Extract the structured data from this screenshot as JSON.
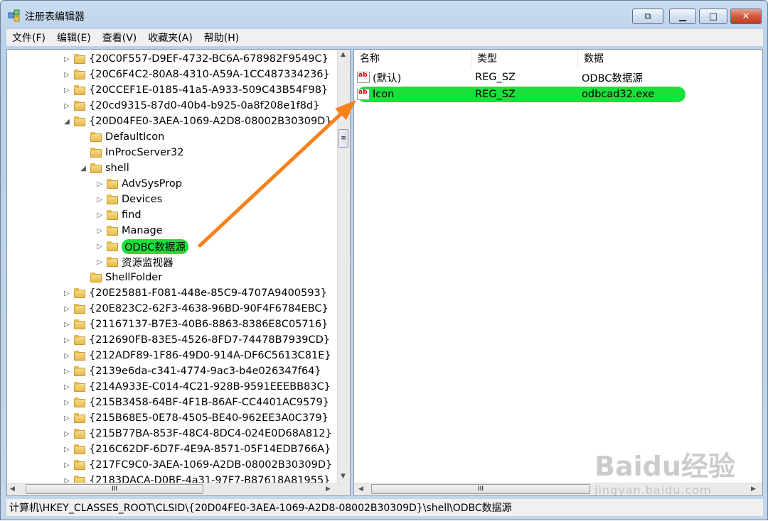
{
  "window": {
    "title": "注册表编辑器"
  },
  "menu": [
    "文件(F)",
    "编辑(E)",
    "查看(V)",
    "收藏夹(A)",
    "帮助(H)"
  ],
  "tree": [
    {
      "label": "{20C0F557-D9EF-4732-BC6A-678982F9549C}",
      "level": 0,
      "expander": "collapsed"
    },
    {
      "label": "{20C6F4C2-80A8-4310-A59A-1CC487334236}",
      "level": 0,
      "expander": "collapsed"
    },
    {
      "label": "{20CCEF1E-0185-41a5-A933-509C43B54F98}",
      "level": 0,
      "expander": "collapsed"
    },
    {
      "label": "{20cd9315-87d0-40b4-b925-0a8f208e1f8d}",
      "level": 0,
      "expander": "collapsed"
    },
    {
      "label": "{20D04FE0-3AEA-1069-A2D8-08002B30309D}",
      "level": 0,
      "expander": "expanded"
    },
    {
      "label": "DefaultIcon",
      "level": 1,
      "expander": "none"
    },
    {
      "label": "InProcServer32",
      "level": 1,
      "expander": "none"
    },
    {
      "label": "shell",
      "level": 1,
      "expander": "expanded"
    },
    {
      "label": "AdvSysProp",
      "level": 2,
      "expander": "collapsed"
    },
    {
      "label": "Devices",
      "level": 2,
      "expander": "collapsed"
    },
    {
      "label": "find",
      "level": 2,
      "expander": "collapsed"
    },
    {
      "label": "Manage",
      "level": 2,
      "expander": "collapsed"
    },
    {
      "label": "ODBC数据源",
      "level": 2,
      "expander": "collapsed",
      "highlight": true
    },
    {
      "label": "资源监视器",
      "level": 2,
      "expander": "collapsed"
    },
    {
      "label": "ShellFolder",
      "level": 1,
      "expander": "none"
    },
    {
      "label": "{20E25881-F081-448e-85C9-4707A9400593}",
      "level": 0,
      "expander": "collapsed"
    },
    {
      "label": "{20E823C2-62F3-4638-96BD-90F4F6784EBC}",
      "level": 0,
      "expander": "collapsed"
    },
    {
      "label": "{21167137-B7E3-40B6-8863-8386E8C05716}",
      "level": 0,
      "expander": "collapsed"
    },
    {
      "label": "{212690FB-83E5-4526-8FD7-74478B7939CD}",
      "level": 0,
      "expander": "collapsed"
    },
    {
      "label": "{212ADF89-1F86-49D0-914A-DF6C5613C81E}",
      "level": 0,
      "expander": "collapsed"
    },
    {
      "label": "{2139e6da-c341-4774-9ac3-b4e026347f64}",
      "level": 0,
      "expander": "collapsed"
    },
    {
      "label": "{214A933E-C014-4C21-928B-9591EEEBB83C}",
      "level": 0,
      "expander": "collapsed"
    },
    {
      "label": "{215B3458-64BF-4F1B-86AF-CC4401AC9579}",
      "level": 0,
      "expander": "collapsed"
    },
    {
      "label": "{215B68E5-0E78-4505-BE40-962EE3A0C379}",
      "level": 0,
      "expander": "collapsed"
    },
    {
      "label": "{215B77BA-853F-48C4-8DC4-024E0D68A812}",
      "level": 0,
      "expander": "collapsed"
    },
    {
      "label": "{216C62DF-6D7F-4E9A-8571-05F14EDB766A}",
      "level": 0,
      "expander": "collapsed"
    },
    {
      "label": "{217FC9C0-3AEA-1069-A2DB-08002B30309D}",
      "level": 0,
      "expander": "collapsed"
    },
    {
      "label": "{2183DACA-D0BF-4a31-97F7-B87618A81955}",
      "level": 0,
      "expander": "collapsed"
    }
  ],
  "list": {
    "columns": [
      "名称",
      "类型",
      "数据"
    ],
    "rows": [
      {
        "name": "(默认)",
        "type": "REG_SZ",
        "data": "ODBC数据源",
        "highlight": false
      },
      {
        "name": "Icon",
        "type": "REG_SZ",
        "data": "odbcad32.exe",
        "highlight": true
      }
    ]
  },
  "status": "计算机\\HKEY_CLASSES_ROOT\\CLSID\\{20D04FE0-3AEA-1069-A2D8-08002B30309D}\\shell\\ODBC数据源",
  "watermark": {
    "brand": "Baidu经验",
    "url": "jingyan.baidu.com"
  },
  "colors": {
    "highlight": "#19e03a",
    "arrow": "#f7821b"
  }
}
